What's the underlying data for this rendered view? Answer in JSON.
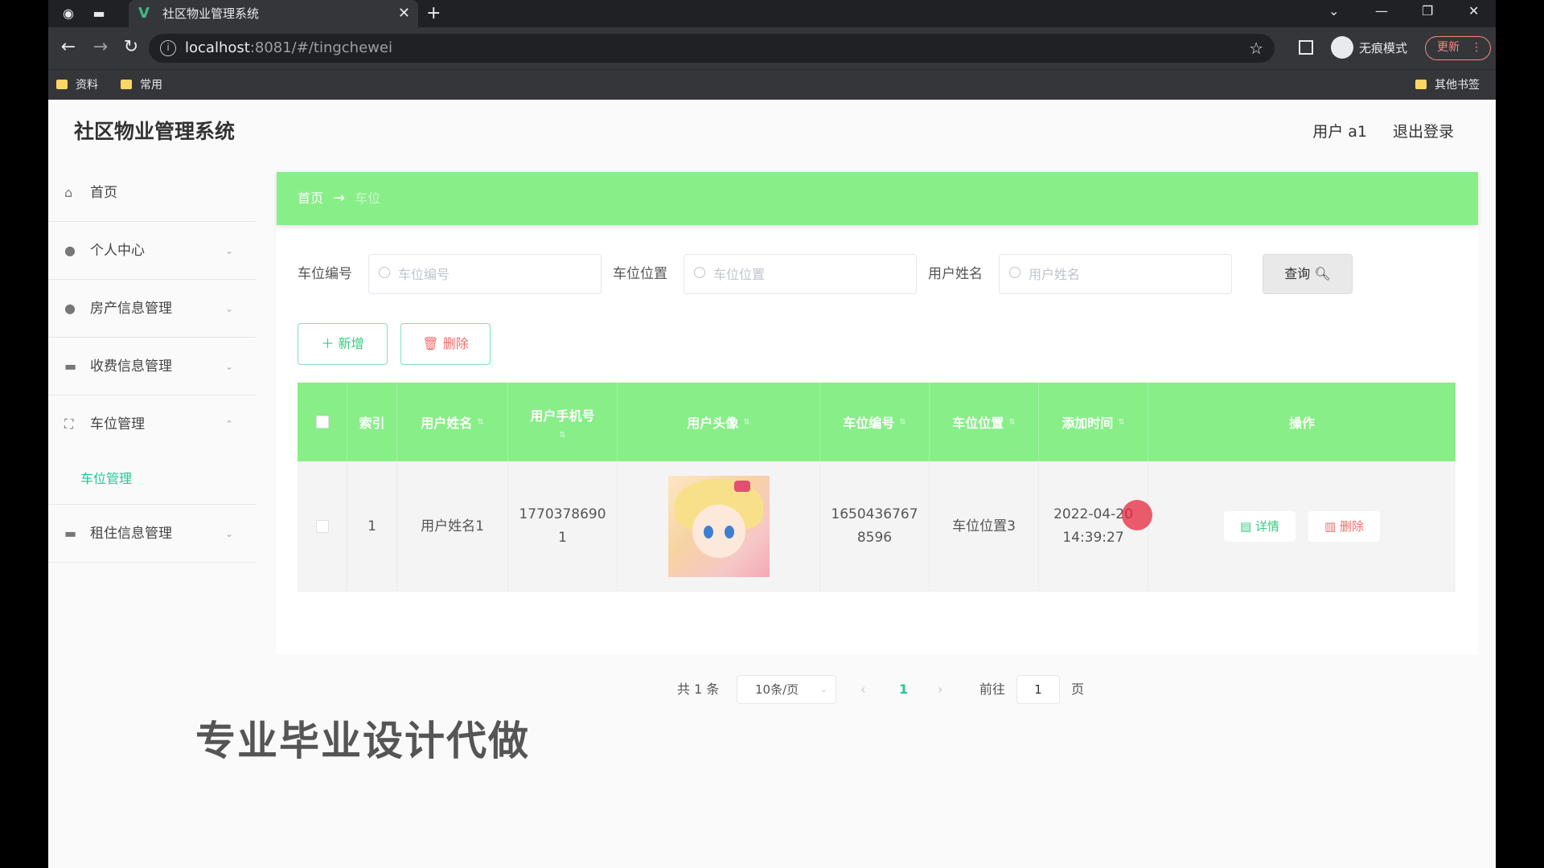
{
  "browser": {
    "tab_title": "社区物业管理系统",
    "url_host": "localhost",
    "url_rest": ":8081/#/tingchewei",
    "incognito_label": "无痕模式",
    "update_label": "更新",
    "bookmarks": [
      "资料",
      "常用"
    ],
    "other_bookmarks": "其他书签"
  },
  "app": {
    "title": "社区物业管理系统",
    "user": "用户 a1",
    "logout": "退出登录"
  },
  "sidebar": {
    "items": [
      {
        "label": "首页"
      },
      {
        "label": "个人中心"
      },
      {
        "label": "房产信息管理"
      },
      {
        "label": "收费信息管理"
      },
      {
        "label": "车位管理"
      },
      {
        "label": "车位管理"
      },
      {
        "label": "租住信息管理"
      }
    ]
  },
  "breadcrumb": {
    "home": "首页",
    "arrow": "→",
    "current": "车位"
  },
  "search": {
    "f1_label": "车位编号",
    "f1_placeholder": "车位编号",
    "f2_label": "车位位置",
    "f2_placeholder": "车位位置",
    "f3_label": "用户姓名",
    "f3_placeholder": "用户姓名",
    "query": "查询"
  },
  "actions": {
    "add": "新增",
    "delete": "删除"
  },
  "table": {
    "headers": [
      "索引",
      "用户姓名",
      "用户手机号",
      "用户头像",
      "车位编号",
      "车位位置",
      "添加时间",
      "操作"
    ],
    "rows": [
      {
        "index": "1",
        "name": "用户姓名1",
        "phone_a": "1770378690",
        "phone_b": "1",
        "code_a": "1650436767",
        "code_b": "8596",
        "location": "车位位置3",
        "time_a": "2022-04-20",
        "time_b": "14:39:27",
        "detail": "详情",
        "remove": "删除"
      }
    ]
  },
  "pager": {
    "total": "共 1 条",
    "page_size": "10条/页",
    "current": "1",
    "goto": "前往",
    "goto_value": "1",
    "page_unit": "页"
  },
  "overlay": {
    "text": "专业毕业设计代做"
  },
  "colors": {
    "accent": "#88ee88",
    "active": "#20c997",
    "danger": "#f56c6c"
  }
}
